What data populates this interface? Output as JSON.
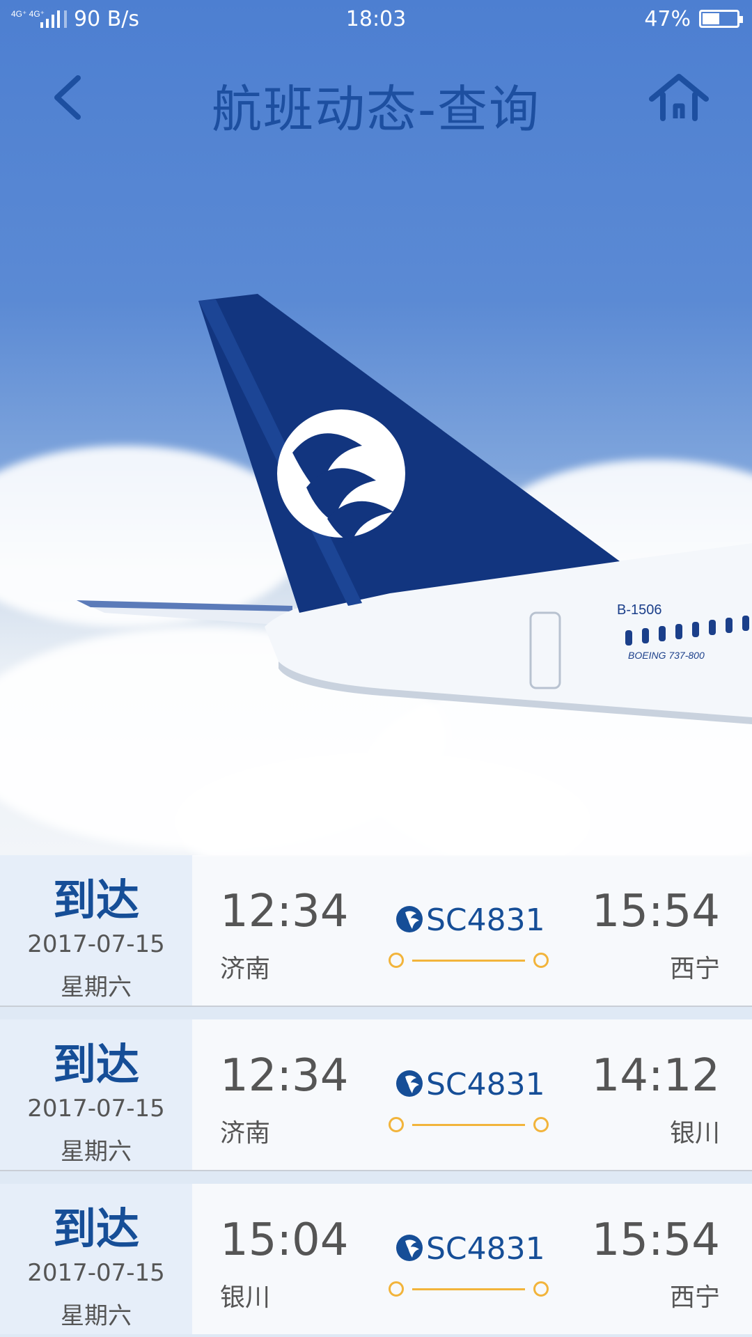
{
  "status_bar": {
    "network": "4G⁺ 4G⁺",
    "speed": "90 B/s",
    "time": "18:03",
    "battery": "47%",
    "battery_level": 0.47
  },
  "header": {
    "title": "航班动态-查询",
    "back_icon": "chevron-left-icon",
    "home_icon": "home-icon"
  },
  "hero": {
    "tail_text": "B-1506",
    "fuselage_text": "BOEING 737-800"
  },
  "colors": {
    "brand": "#164e97",
    "accent": "#f2b43b",
    "sky": "#4d7fd1"
  },
  "flights": [
    {
      "status": "到达",
      "date": "2017-07-15",
      "weekday": "星期六",
      "dep_time": "12:34",
      "dep_city": "济南",
      "flight_no": "SC4831",
      "arr_time": "15:54",
      "arr_city": "西宁"
    },
    {
      "status": "到达",
      "date": "2017-07-15",
      "weekday": "星期六",
      "dep_time": "12:34",
      "dep_city": "济南",
      "flight_no": "SC4831",
      "arr_time": "14:12",
      "arr_city": "银川"
    },
    {
      "status": "到达",
      "date": "2017-07-15",
      "weekday": "星期六",
      "dep_time": "15:04",
      "dep_city": "银川",
      "flight_no": "SC4831",
      "arr_time": "15:54",
      "arr_city": "西宁"
    }
  ]
}
